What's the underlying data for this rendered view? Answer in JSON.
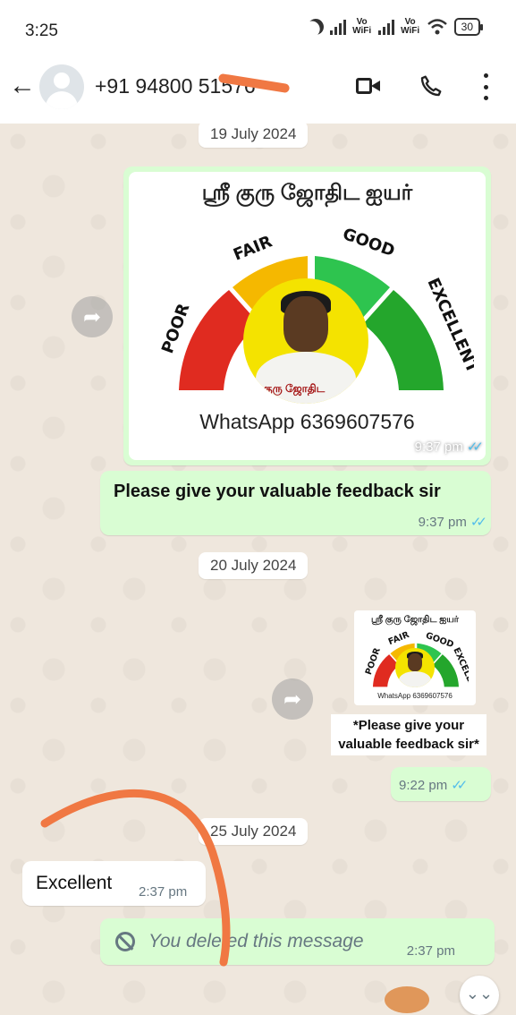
{
  "status_bar": {
    "time": "3:25",
    "vowifi_1": "Vo WiFi",
    "vowifi_2": "Vo WiFi",
    "battery": "30"
  },
  "header": {
    "contact_name": "+91 94800 51576",
    "icons": [
      "back-arrow-icon",
      "avatar",
      "video-call-icon",
      "phone-icon",
      "more-options-icon"
    ]
  },
  "messages": {
    "date_1": "19 July 2024",
    "image_1": {
      "title": "ஸ்ரீ குரு ஜோதிட ஐயர்",
      "gauge_labels": [
        "POOR",
        "FAIR",
        "GOOD",
        "EXCELLENT"
      ],
      "photo_banner": "குரு ஜோதிட",
      "caption": "WhatsApp 6369607576",
      "time": "9:37 pm"
    },
    "text_1": {
      "text": "Please give your valuable feedback sir",
      "time": "9:37 pm"
    },
    "date_2": "20 July 2024",
    "sticker_1": {
      "title": "ஸ்ரீ குரு ஜோதிட ஐயர்",
      "gauge_labels": [
        "POOR",
        "FAIR",
        "GOOD",
        "EXCELLENT"
      ],
      "caption": "WhatsApp 6369607576",
      "text_line_1": "*Please give your",
      "text_line_2": "valuable feedback sir*",
      "time": "9:22 pm"
    },
    "date_3": "25 July 2024",
    "incoming_1": {
      "text": "Excellent",
      "time": "2:37 pm"
    },
    "deleted_1": {
      "text": "You deleted this message",
      "time": "2:37 pm"
    }
  },
  "colors": {
    "outgoing_bubble": "#d9fdd3",
    "incoming_bubble": "#ffffff",
    "read_ticks": "#53bdeb",
    "gauge_poor": "#e02b20",
    "gauge_fair": "#f5b800",
    "gauge_good": "#2ec44f",
    "gauge_excellent": "#24a62c",
    "scribble": "#f07843"
  }
}
